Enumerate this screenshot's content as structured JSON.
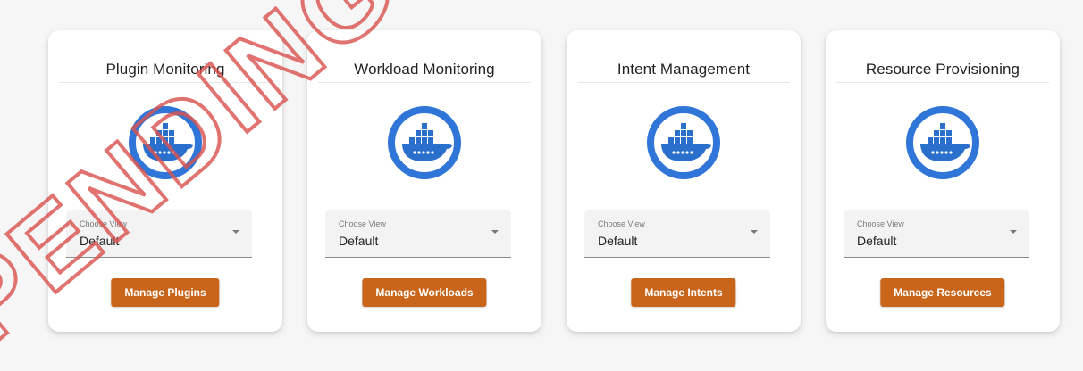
{
  "cards": [
    {
      "title": "Plugin Monitoring",
      "logo_icon": "docker-whale-icon",
      "select_label": "Choose View",
      "select_value": "Default",
      "button_label": "Manage Plugins"
    },
    {
      "title": "Workload Monitoring",
      "logo_icon": "docker-whale-icon",
      "select_label": "Choose View",
      "select_value": "Default",
      "button_label": "Manage Workloads"
    },
    {
      "title": "Intent Management",
      "logo_icon": "docker-whale-icon",
      "select_label": "Choose View",
      "select_value": "Default",
      "button_label": "Manage Intents"
    },
    {
      "title": "Resource Provisioning",
      "logo_icon": "docker-whale-icon",
      "select_label": "Choose View",
      "select_value": "Default",
      "button_label": "Manage Resources"
    }
  ],
  "watermark": {
    "text": "PENDING",
    "color": "#d9534f"
  },
  "colors": {
    "accent_button": "#c8651a",
    "logo_ring": "#2f76d8",
    "whale": "#2a6fcc"
  }
}
